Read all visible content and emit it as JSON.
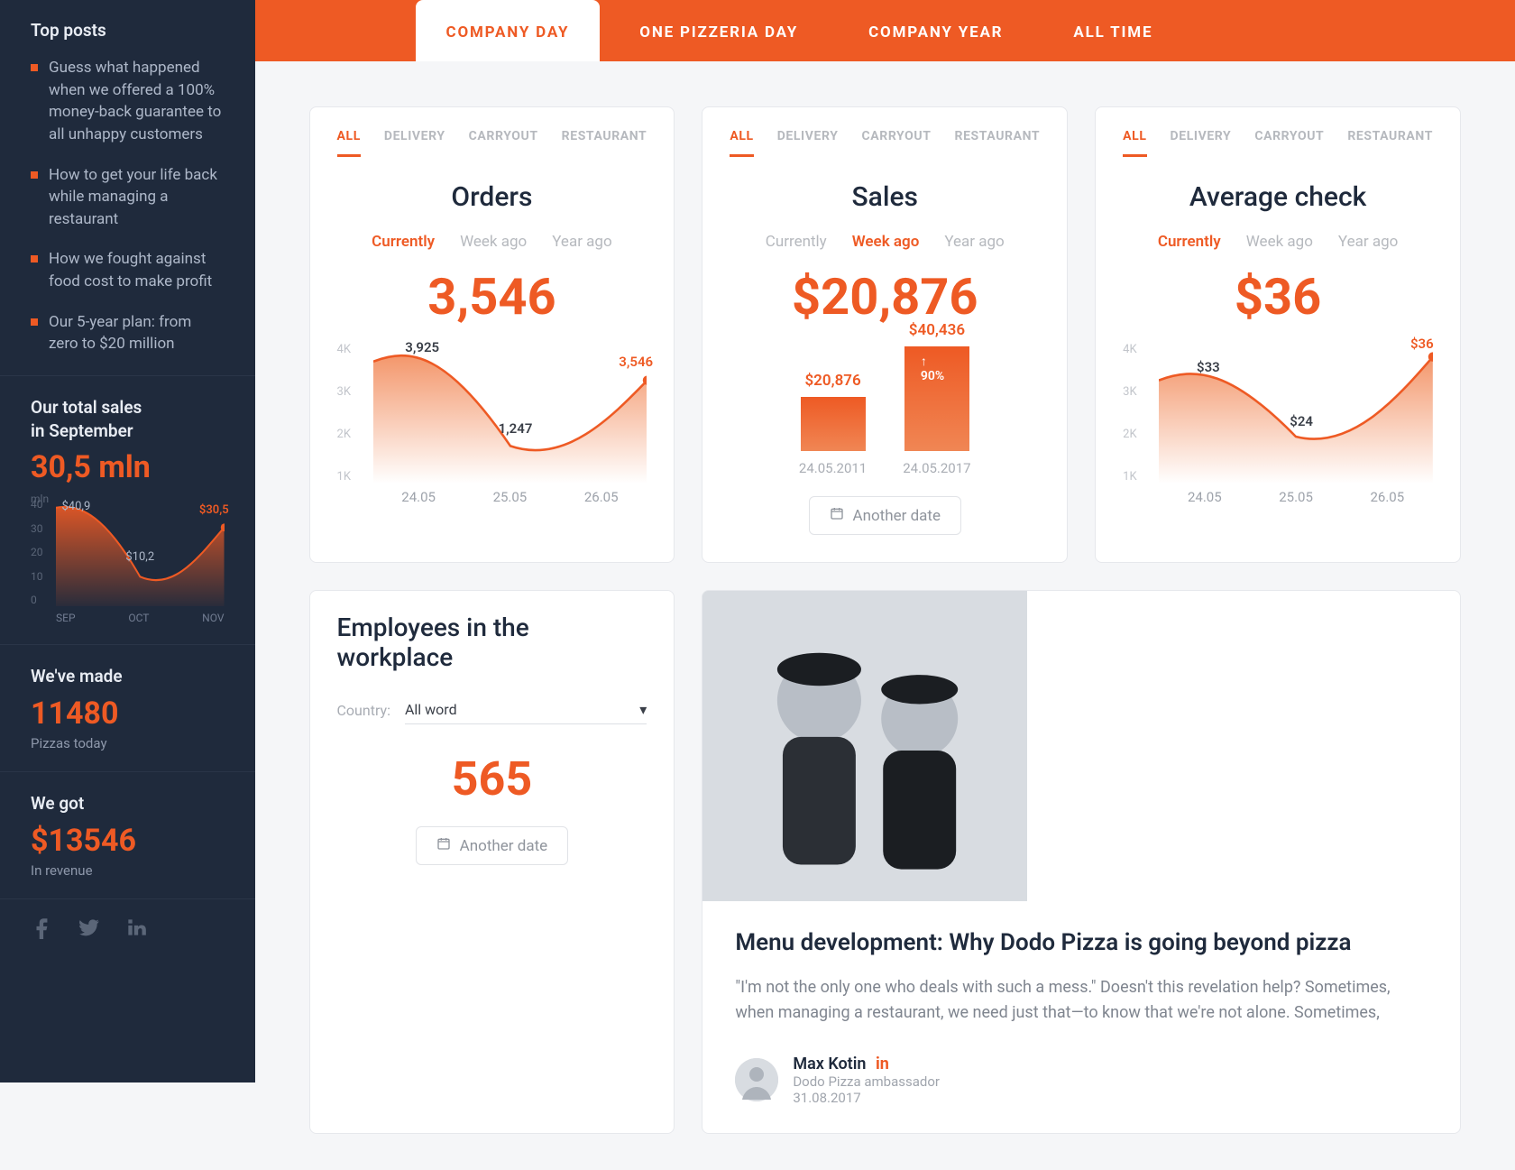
{
  "sidebar": {
    "top_posts": {
      "title": "Top posts",
      "items": [
        "Guess what happened when we offered a 100% money-back guarantee to all unhappy customers",
        "How to get your life back while managing a restaurant",
        "How we fought against food cost to make profit",
        "Our 5-year plan: from zero to $20 million"
      ]
    },
    "total_sales": {
      "title_l1": "Our total sales",
      "title_l2": "in September",
      "value": "30,5 mln",
      "unit": "mln"
    },
    "pizzas": {
      "title": "We've made",
      "value": "11480",
      "sub": "Pizzas today"
    },
    "revenue": {
      "title": "We got",
      "value": "$13546",
      "sub": "In revenue"
    }
  },
  "tabs": [
    "COMPANY DAY",
    "ONE PIZZERIA DAY",
    "COMPANY YEAR",
    "ALL TIME"
  ],
  "card_tabs": [
    "ALL",
    "DELIVERY",
    "CARRYOUT",
    "RESTAURANT"
  ],
  "periods": [
    "Currently",
    "Week ago",
    "Year ago"
  ],
  "orders": {
    "title": "Orders",
    "value": "3,546",
    "active_period": 0
  },
  "sales": {
    "title": "Sales",
    "value": "$20,876",
    "active_period": 1
  },
  "avg": {
    "title": "Average check",
    "value": "$36",
    "active_period": 0
  },
  "another_date": "Another date",
  "employees": {
    "title": "Employees in the workplace",
    "country_label": "Country:",
    "country_value": "All word",
    "value": "565"
  },
  "article": {
    "title": "Menu development: Why Dodo Pizza is going beyond pizza",
    "text": "\"I'm not the only one who deals with such a mess.\" Doesn't this revelation help? Sometimes, when managing a restaurant, we need just that—to know that we're not alone. Sometimes,",
    "author": "Max Kotin",
    "role": "Dodo Pizza ambassador",
    "date": "31.08.2017",
    "linkedin": "in"
  },
  "chart_data": [
    {
      "id": "sidebar-total-sales",
      "type": "area",
      "categories": [
        "SEP",
        "OCT",
        "NOV"
      ],
      "values": [
        40.9,
        10.2,
        30.5
      ],
      "data_labels": [
        "$40,9",
        "$10,2",
        "$30,5"
      ],
      "ylabel": "mln",
      "ylim": [
        0,
        40
      ],
      "yticks": [
        40,
        30,
        20,
        10,
        0
      ]
    },
    {
      "id": "orders",
      "type": "area",
      "categories": [
        "24.05",
        "25.05",
        "26.05"
      ],
      "values": [
        3925,
        1247,
        3546
      ],
      "data_labels": [
        "3,925",
        "1,247",
        "3,546"
      ],
      "ylim": [
        0,
        4000
      ],
      "yticks": [
        "4K",
        "3K",
        "2K",
        "1K"
      ]
    },
    {
      "id": "sales",
      "type": "bar",
      "categories": [
        "24.05.2011",
        "24.05.2017"
      ],
      "values": [
        20876,
        40436
      ],
      "data_labels": [
        "$20,876",
        "$40,436"
      ],
      "badge_on_second": "↑ 90%"
    },
    {
      "id": "avg-check",
      "type": "area",
      "categories": [
        "24.05",
        "25.05",
        "26.05"
      ],
      "values": [
        33,
        24,
        36
      ],
      "data_labels": [
        "$33",
        "$24",
        "$36"
      ],
      "ylim": [
        0,
        4000
      ],
      "yticks": [
        "4K",
        "3K",
        "2K",
        "1K"
      ]
    }
  ]
}
